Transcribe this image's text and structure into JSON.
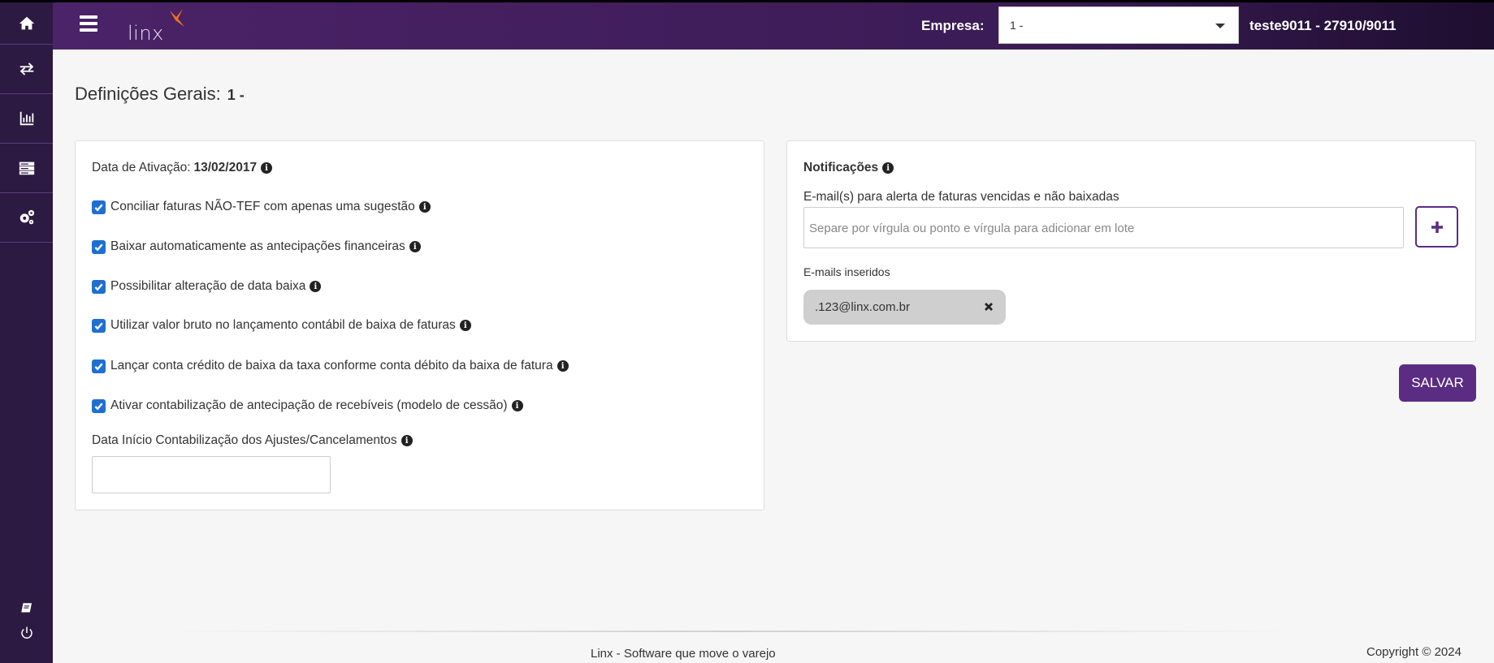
{
  "sidebar": {
    "items": [
      {
        "icon": "home-icon"
      },
      {
        "icon": "transfer-icon"
      },
      {
        "icon": "chart-icon"
      },
      {
        "icon": "server-icon"
      },
      {
        "icon": "settings-icon"
      }
    ],
    "bottom": [
      {
        "icon": "book-icon"
      },
      {
        "icon": "power-icon"
      }
    ]
  },
  "header": {
    "logo_text": "linx",
    "empresa_label": "Empresa:",
    "empresa_value": "1 -",
    "user": "teste9011 - 27910/9011"
  },
  "page": {
    "title": "Definições Gerais:",
    "title_value": "1 -"
  },
  "general": {
    "activation_label": "Data de Ativação:",
    "activation_date": "13/02/2017",
    "options": [
      "Conciliar faturas NÃO-TEF com apenas uma sugestão",
      "Baixar automaticamente as antecipações financeiras",
      "Possibilitar alteração de data baixa",
      "Utilizar valor bruto no lançamento contábil de baixa de faturas",
      "Lançar conta crédito de baixa da taxa conforme conta débito da baixa de fatura",
      "Ativar contabilização de antecipação de recebíveis (modelo de cessão)"
    ],
    "start_date_label": "Data Início Contabilização dos Ajustes/Cancelamentos",
    "start_date_value": ""
  },
  "notifications": {
    "title": "Notificações",
    "email_label": "E-mail(s) para alerta de faturas vencidas e não baixadas",
    "email_placeholder": "Separe por vírgula ou ponto e vírgula para adicionar em lote",
    "inserted_label": "E-mails inseridos",
    "emails": [
      ".123@linx.com.br"
    ]
  },
  "actions": {
    "save_label": "SALVAR"
  },
  "footer": {
    "tagline": "Linx - Software que move o varejo",
    "copyright": "Copyright © 2024"
  },
  "colors": {
    "brand": "#5a2d82",
    "sidebar": "#2c1a42",
    "checkbox": "#1f6fd1"
  }
}
